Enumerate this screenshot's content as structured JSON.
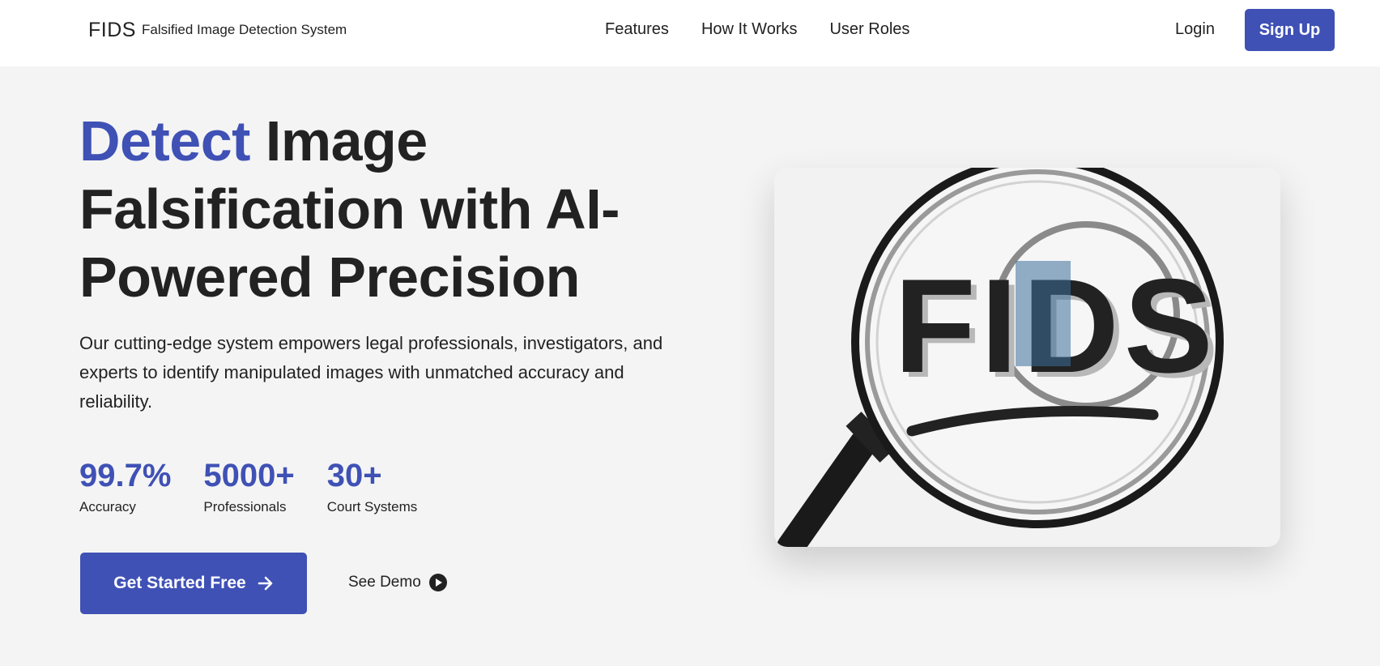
{
  "nav": {
    "logo": "FIDS",
    "tagline": "Falsified Image Detection System",
    "links": [
      "Features",
      "How It Works",
      "User Roles"
    ],
    "login": "Login",
    "signup": "Sign Up"
  },
  "hero": {
    "headline_accent": "Detect",
    "headline_rest": " Image Falsification with AI-Powered Precision",
    "description": "Our cutting-edge system empowers legal professionals, investigators, and experts to identify manipulated images with unmatched accuracy and reliability.",
    "stats": [
      {
        "value": "99.7%",
        "label": "Accuracy"
      },
      {
        "value": "5000+",
        "label": "Professionals"
      },
      {
        "value": "30+",
        "label": "Court Systems"
      }
    ],
    "cta": "Get Started Free",
    "demo": "See Demo",
    "image_text": "FIDS"
  },
  "colors": {
    "accent": "#3f51b5"
  }
}
